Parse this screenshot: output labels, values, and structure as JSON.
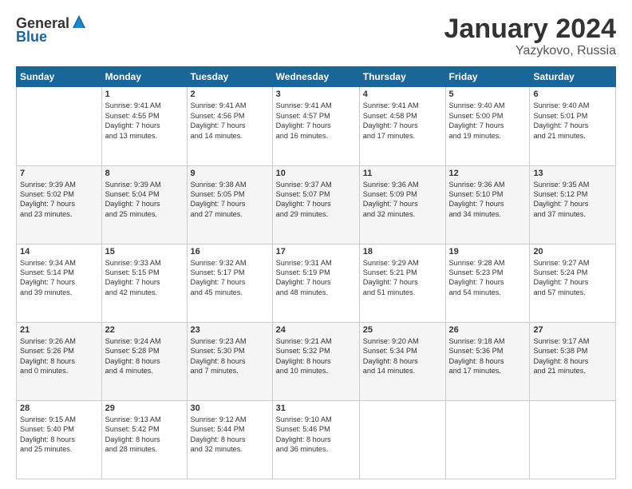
{
  "logo": {
    "general": "General",
    "blue": "Blue"
  },
  "title": "January 2024",
  "location": "Yazykovo, Russia",
  "days_header": [
    "Sunday",
    "Monday",
    "Tuesday",
    "Wednesday",
    "Thursday",
    "Friday",
    "Saturday"
  ],
  "weeks": [
    [
      {
        "day": "",
        "info": ""
      },
      {
        "day": "1",
        "info": "Sunrise: 9:41 AM\nSunset: 4:55 PM\nDaylight: 7 hours\nand 13 minutes."
      },
      {
        "day": "2",
        "info": "Sunrise: 9:41 AM\nSunset: 4:56 PM\nDaylight: 7 hours\nand 14 minutes."
      },
      {
        "day": "3",
        "info": "Sunrise: 9:41 AM\nSunset: 4:57 PM\nDaylight: 7 hours\nand 16 minutes."
      },
      {
        "day": "4",
        "info": "Sunrise: 9:41 AM\nSunset: 4:58 PM\nDaylight: 7 hours\nand 17 minutes."
      },
      {
        "day": "5",
        "info": "Sunrise: 9:40 AM\nSunset: 5:00 PM\nDaylight: 7 hours\nand 19 minutes."
      },
      {
        "day": "6",
        "info": "Sunrise: 9:40 AM\nSunset: 5:01 PM\nDaylight: 7 hours\nand 21 minutes."
      }
    ],
    [
      {
        "day": "7",
        "info": "Sunrise: 9:39 AM\nSunset: 5:02 PM\nDaylight: 7 hours\nand 23 minutes."
      },
      {
        "day": "8",
        "info": "Sunrise: 9:39 AM\nSunset: 5:04 PM\nDaylight: 7 hours\nand 25 minutes."
      },
      {
        "day": "9",
        "info": "Sunrise: 9:38 AM\nSunset: 5:05 PM\nDaylight: 7 hours\nand 27 minutes."
      },
      {
        "day": "10",
        "info": "Sunrise: 9:37 AM\nSunset: 5:07 PM\nDaylight: 7 hours\nand 29 minutes."
      },
      {
        "day": "11",
        "info": "Sunrise: 9:36 AM\nSunset: 5:09 PM\nDaylight: 7 hours\nand 32 minutes."
      },
      {
        "day": "12",
        "info": "Sunrise: 9:36 AM\nSunset: 5:10 PM\nDaylight: 7 hours\nand 34 minutes."
      },
      {
        "day": "13",
        "info": "Sunrise: 9:35 AM\nSunset: 5:12 PM\nDaylight: 7 hours\nand 37 minutes."
      }
    ],
    [
      {
        "day": "14",
        "info": "Sunrise: 9:34 AM\nSunset: 5:14 PM\nDaylight: 7 hours\nand 39 minutes."
      },
      {
        "day": "15",
        "info": "Sunrise: 9:33 AM\nSunset: 5:15 PM\nDaylight: 7 hours\nand 42 minutes."
      },
      {
        "day": "16",
        "info": "Sunrise: 9:32 AM\nSunset: 5:17 PM\nDaylight: 7 hours\nand 45 minutes."
      },
      {
        "day": "17",
        "info": "Sunrise: 9:31 AM\nSunset: 5:19 PM\nDaylight: 7 hours\nand 48 minutes."
      },
      {
        "day": "18",
        "info": "Sunrise: 9:29 AM\nSunset: 5:21 PM\nDaylight: 7 hours\nand 51 minutes."
      },
      {
        "day": "19",
        "info": "Sunrise: 9:28 AM\nSunset: 5:23 PM\nDaylight: 7 hours\nand 54 minutes."
      },
      {
        "day": "20",
        "info": "Sunrise: 9:27 AM\nSunset: 5:24 PM\nDaylight: 7 hours\nand 57 minutes."
      }
    ],
    [
      {
        "day": "21",
        "info": "Sunrise: 9:26 AM\nSunset: 5:26 PM\nDaylight: 8 hours\nand 0 minutes."
      },
      {
        "day": "22",
        "info": "Sunrise: 9:24 AM\nSunset: 5:28 PM\nDaylight: 8 hours\nand 4 minutes."
      },
      {
        "day": "23",
        "info": "Sunrise: 9:23 AM\nSunset: 5:30 PM\nDaylight: 8 hours\nand 7 minutes."
      },
      {
        "day": "24",
        "info": "Sunrise: 9:21 AM\nSunset: 5:32 PM\nDaylight: 8 hours\nand 10 minutes."
      },
      {
        "day": "25",
        "info": "Sunrise: 9:20 AM\nSunset: 5:34 PM\nDaylight: 8 hours\nand 14 minutes."
      },
      {
        "day": "26",
        "info": "Sunrise: 9:18 AM\nSunset: 5:36 PM\nDaylight: 8 hours\nand 17 minutes."
      },
      {
        "day": "27",
        "info": "Sunrise: 9:17 AM\nSunset: 5:38 PM\nDaylight: 8 hours\nand 21 minutes."
      }
    ],
    [
      {
        "day": "28",
        "info": "Sunrise: 9:15 AM\nSunset: 5:40 PM\nDaylight: 8 hours\nand 25 minutes."
      },
      {
        "day": "29",
        "info": "Sunrise: 9:13 AM\nSunset: 5:42 PM\nDaylight: 8 hours\nand 28 minutes."
      },
      {
        "day": "30",
        "info": "Sunrise: 9:12 AM\nSunset: 5:44 PM\nDaylight: 8 hours\nand 32 minutes."
      },
      {
        "day": "31",
        "info": "Sunrise: 9:10 AM\nSunset: 5:46 PM\nDaylight: 8 hours\nand 36 minutes."
      },
      {
        "day": "",
        "info": ""
      },
      {
        "day": "",
        "info": ""
      },
      {
        "day": "",
        "info": ""
      }
    ]
  ]
}
